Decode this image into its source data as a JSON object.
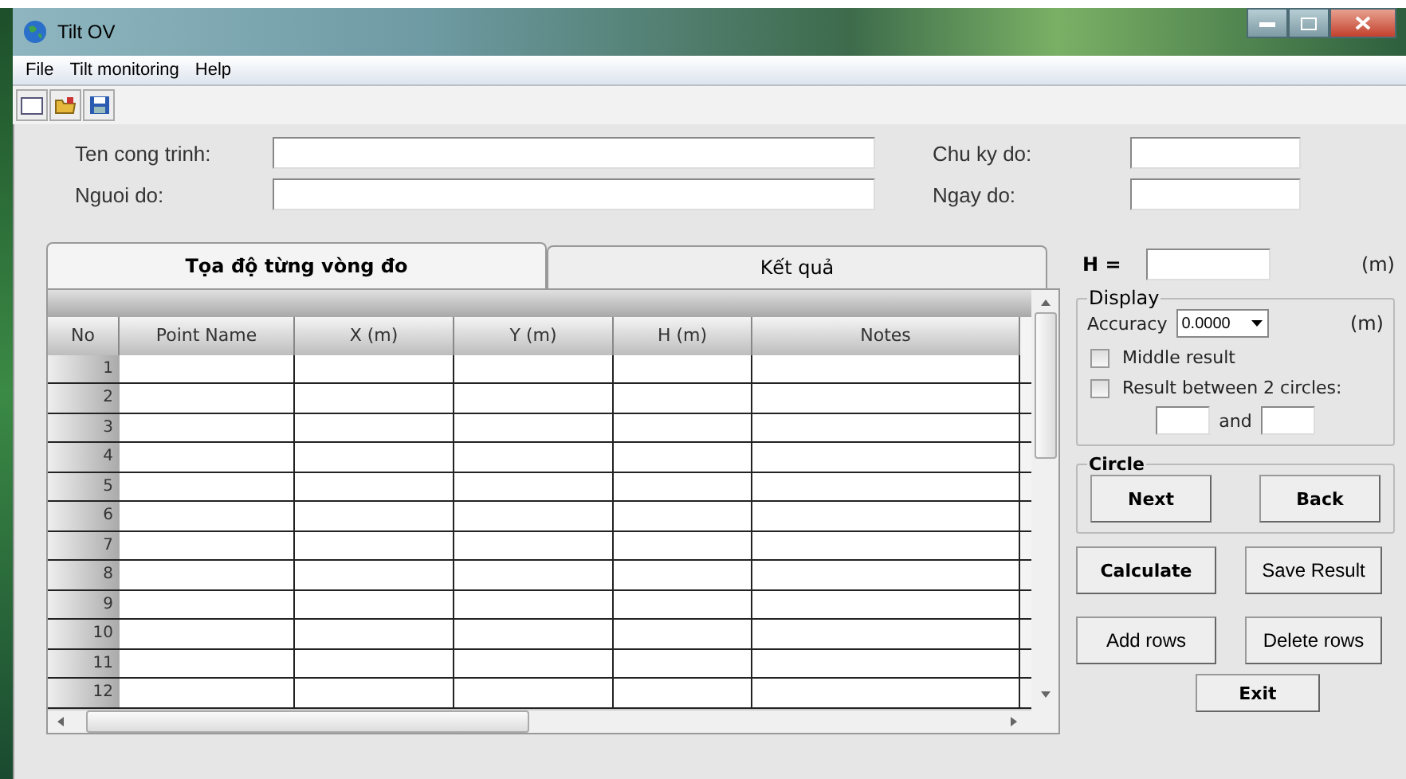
{
  "window": {
    "title": "Tilt OV"
  },
  "menu": [
    "File",
    "Tilt monitoring",
    "Help"
  ],
  "form": {
    "left": [
      {
        "label": "Ten cong trinh:"
      },
      {
        "label": "Nguoi do:"
      }
    ],
    "right": [
      {
        "label": "Chu ky do:"
      },
      {
        "label": "Ngay do:"
      }
    ]
  },
  "tabs": [
    {
      "label": "Tọa độ từng vòng đo",
      "selected": true
    },
    {
      "label": "Kết quả",
      "selected": false
    }
  ],
  "table": {
    "columns": [
      "No",
      "Point Name",
      "X (m)",
      "Y (m)",
      "H (m)",
      "Notes"
    ],
    "rows": [
      "1",
      "2",
      "3",
      "4",
      "5",
      "6",
      "7",
      "8",
      "9",
      "10",
      "11",
      "12"
    ]
  },
  "height": {
    "label": "H =",
    "unit": "(m)"
  },
  "display": {
    "title": "Display",
    "accuracy_label": "Accuracy",
    "accuracy_value": "0.0000",
    "unit": "(m)",
    "options": [
      {
        "label": "Middle result",
        "checked": false
      },
      {
        "label": "Result between 2 circles:",
        "checked": false
      }
    ],
    "between_label": "and"
  },
  "circle": {
    "title": "Circle",
    "buttons": [
      "Next",
      "Back"
    ]
  },
  "actions": [
    {
      "label": "Calculate",
      "bold": true
    },
    {
      "label": "Save Result",
      "bold": false
    },
    {
      "label": "Add rows",
      "bold": false
    },
    {
      "label": "Delete rows",
      "bold": false
    }
  ],
  "exit": "Exit"
}
